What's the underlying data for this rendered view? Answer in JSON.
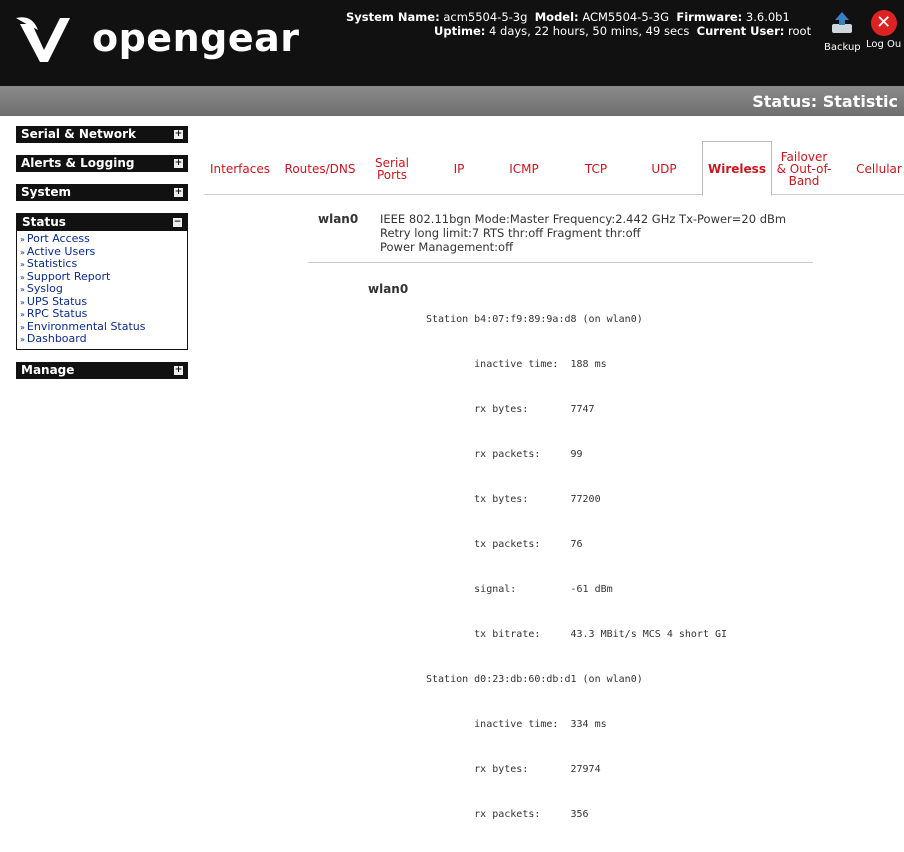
{
  "header": {
    "logo_text": "opengear",
    "system_name_label": "System Name:",
    "system_name": "acm5504-5-3g",
    "model_label": "Model:",
    "model": "ACM5504-5-3G",
    "firmware_label": "Firmware:",
    "firmware": "3.6.0b1",
    "uptime_label": "Uptime:",
    "uptime": "4 days, 22 hours, 50 mins, 49 secs",
    "current_user_label": "Current User:",
    "current_user": "root",
    "backup_label": "Backup",
    "logout_label": "Log Ou"
  },
  "page_title": "Status: Statistic",
  "sidebar": {
    "menus": [
      {
        "label": "Serial & Network",
        "state": "+"
      },
      {
        "label": "Alerts & Logging",
        "state": "+"
      },
      {
        "label": "System",
        "state": "+"
      }
    ],
    "status": {
      "label": "Status",
      "state": "−",
      "items": [
        "Port Access",
        "Active Users",
        "Statistics",
        "Support Report",
        "Syslog",
        "UPS Status",
        "RPC Status",
        "Environmental Status",
        "Dashboard"
      ]
    },
    "manage": {
      "label": "Manage",
      "state": "+"
    }
  },
  "tabs": [
    {
      "label": "Interfaces"
    },
    {
      "label": "Routes/DNS"
    },
    {
      "label": "Serial Ports"
    },
    {
      "label": "IP"
    },
    {
      "label": "ICMP"
    },
    {
      "label": "TCP"
    },
    {
      "label": "UDP"
    },
    {
      "label": "Wireless"
    },
    {
      "label": "Failover & Out-of-Band"
    },
    {
      "label": "Cellular"
    }
  ],
  "wireless": {
    "iface": "wlan0",
    "desc_line1": "IEEE 802.11bgn Mode:Master Frequency:2.442 GHz Tx-Power=20 dBm",
    "desc_line2": "Retry long limit:7 RTS thr:off Fragment thr:off",
    "desc_line3": "Power Management:off",
    "iface2": "wlan0",
    "station_lines": [
      "Station b4:07:f9:89:9a:d8 (on wlan0)",
      "        inactive time:  188 ms",
      "        rx bytes:       7747",
      "        rx packets:     99",
      "        tx bytes:       77200",
      "        tx packets:     76",
      "        signal:         -61 dBm",
      "        tx bitrate:     43.3 MBit/s MCS 4 short GI",
      "Station d0:23:db:60:db:d1 (on wlan0)",
      "        inactive time:  334 ms",
      "        rx bytes:       27974",
      "        rx packets:     356"
    ]
  }
}
